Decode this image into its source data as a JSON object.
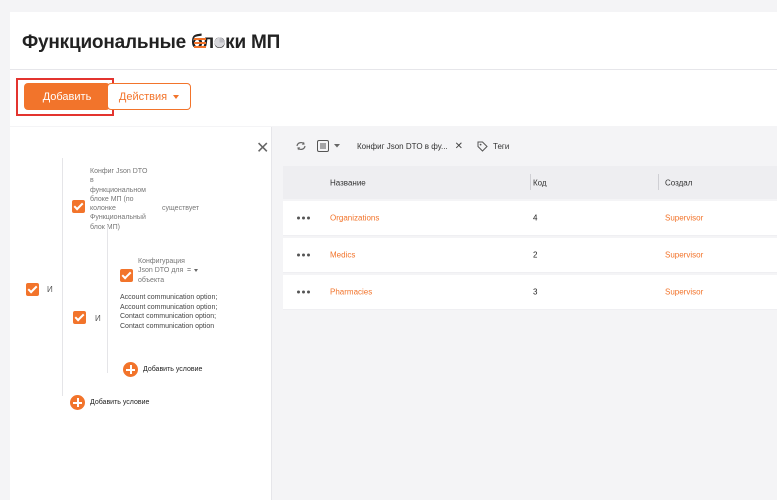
{
  "header": {
    "title": "Функциональные блоки МП",
    "menu_icon": "hamburger-icon",
    "chart_icon": "pie-chart-icon"
  },
  "toolbar": {
    "add_label": "Добавить",
    "actions_label": "Действия"
  },
  "filter": {
    "and_label": "И",
    "outer_condition": [
      "Конфиг Json DTO",
      "в",
      "функциональном",
      "блоке МП (по",
      "колонке",
      "Функциональный",
      "блок МП)"
    ],
    "outer_operator": "существует",
    "inner_and_label": "И",
    "inner_condition": [
      "Конфигурация",
      "Json DTO для",
      "объекта"
    ],
    "inner_operator": "=",
    "inner_values": [
      "Account communication option;",
      "Account communication option;",
      "Contact communication option;",
      "Contact communication option"
    ],
    "add_condition_inner": "Добавить условие",
    "add_condition_outer": "Добавить условие"
  },
  "grid": {
    "filter_chip": "Конфиг Json DTO в фу...",
    "tags_label": "Теги",
    "columns": [
      "Название",
      "Код",
      "Создал"
    ],
    "rows": [
      {
        "name": "Organizations",
        "code": "4",
        "creator": "Supervisor"
      },
      {
        "name": "Medics",
        "code": "2",
        "creator": "Supervisor"
      },
      {
        "name": "Pharmacies",
        "code": "3",
        "creator": "Supervisor"
      }
    ]
  },
  "colors": {
    "accent": "#f2742b",
    "highlight": "#e3342f"
  }
}
